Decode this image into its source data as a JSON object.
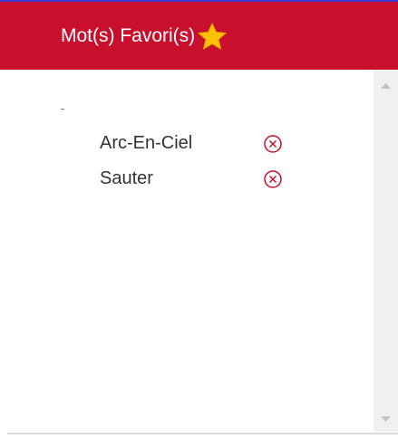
{
  "header": {
    "title": "Mot(s) Favori(s)",
    "star_icon": "star-icon",
    "background": "#c8102e",
    "text_color": "#ffffff"
  },
  "favorites": [
    {
      "label": "Arc-En-Ciel",
      "remove_icon": "circle-x-icon"
    },
    {
      "label": "Sauter",
      "remove_icon": "circle-x-icon"
    }
  ],
  "colors": {
    "remove_icon": "#c8102e",
    "star": "#ffc107",
    "scrollbar_track": "#f0f0f0"
  }
}
